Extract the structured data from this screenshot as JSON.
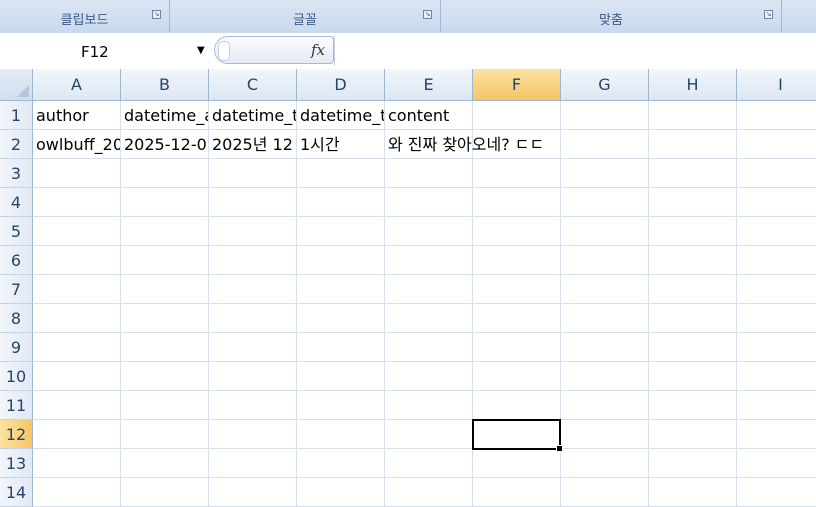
{
  "ribbon": {
    "groups": [
      {
        "label": "클립보드"
      },
      {
        "label": "글꼴"
      },
      {
        "label": "맞춤"
      }
    ]
  },
  "formula_bar": {
    "name_box": "F12",
    "fx_icon": "fx-icon",
    "formula": ""
  },
  "sheet": {
    "columns": [
      "A",
      "B",
      "C",
      "D",
      "E",
      "F",
      "G",
      "H",
      "I"
    ],
    "rows": [
      "1",
      "2",
      "3",
      "4",
      "5",
      "6",
      "7",
      "8",
      "9",
      "10",
      "11",
      "12",
      "13",
      "14"
    ],
    "active_cell": "F12",
    "active_column": "F",
    "active_row": "12",
    "data": [
      [
        "author",
        "datetime_a",
        "datetime_t",
        "datetime_t",
        "content",
        "",
        "",
        "",
        ""
      ],
      [
        "owlbuff_20",
        "2025-12-0",
        "2025년 12",
        "1시간",
        "와 진짜 찾아오네? ㄷㄷ",
        "",
        "",
        "",
        ""
      ]
    ]
  },
  "colors": {
    "header_active": "#f6c567",
    "header_text": "#26456b",
    "gridline": "#d6dfec",
    "ribbon_bg": "#c9d9ee"
  }
}
